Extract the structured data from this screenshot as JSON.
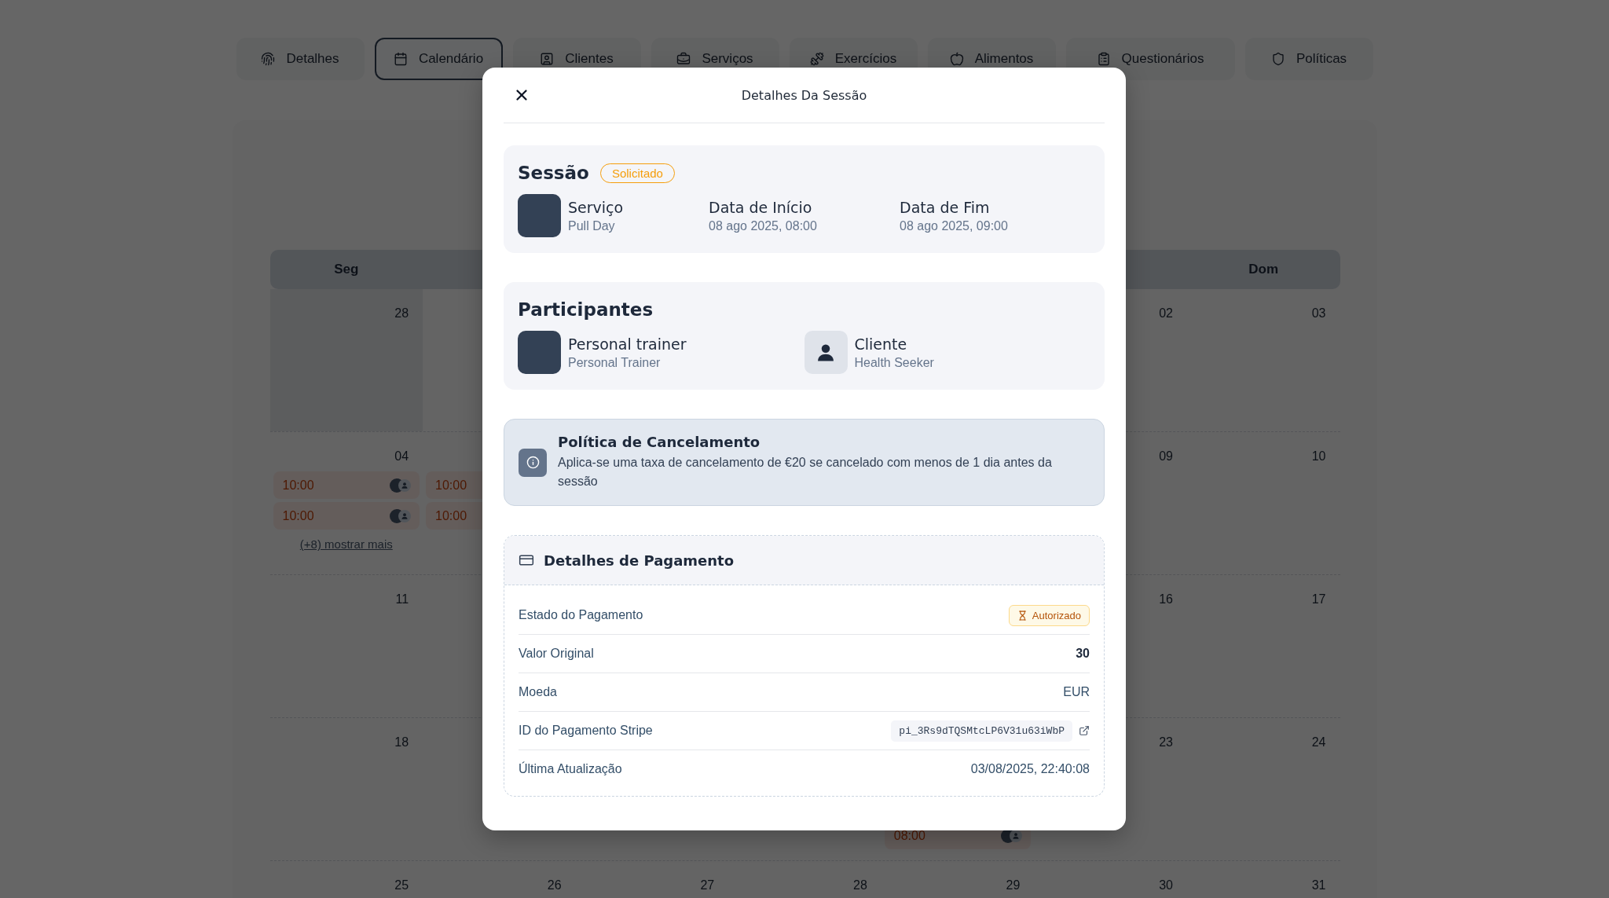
{
  "tabs": [
    {
      "label": "Detalhes",
      "selected": false
    },
    {
      "label": "Calendário",
      "selected": true
    },
    {
      "label": "Clientes",
      "selected": false
    },
    {
      "label": "Serviços",
      "selected": false
    },
    {
      "label": "Exercícios",
      "selected": false
    },
    {
      "label": "Alimentos",
      "selected": false
    },
    {
      "label": "Questionários",
      "selected": false
    },
    {
      "label": "Políticas",
      "selected": false
    }
  ],
  "calendar": {
    "weekdays": {
      "left": [
        "Seg"
      ],
      "right": [
        "Dom"
      ]
    },
    "weeks": [
      {
        "left": [
          {
            "day": "28",
            "in_month": false
          }
        ],
        "right": [
          {
            "day": "02",
            "in_month": true
          },
          {
            "day": "03",
            "in_month": true
          }
        ]
      },
      {
        "left": [
          {
            "day": "04",
            "in_month": true,
            "events": [
              {
                "time": "10:00"
              },
              {
                "time": "10:00"
              }
            ],
            "more_link": "(+8) mostrar mais"
          },
          {
            "events": [
              {
                "time": "10:00"
              },
              {
                "time": "10:00"
              }
            ]
          }
        ],
        "right": [
          {
            "day": "09",
            "in_month": true
          },
          {
            "day": "10",
            "in_month": true
          }
        ]
      },
      {
        "left": [
          {
            "day": "11",
            "in_month": true
          }
        ],
        "right": [
          {
            "day": "16",
            "in_month": true
          },
          {
            "day": "17",
            "in_month": true
          }
        ]
      },
      {
        "left": [
          {
            "day": "18",
            "in_month": true
          }
        ],
        "right": [
          {
            "events": [
              {
                "time": "08:00"
              }
            ]
          },
          {
            "day": "23",
            "in_month": true
          },
          {
            "day": "24",
            "in_month": true
          }
        ]
      },
      {
        "left": [
          {
            "day": "25",
            "in_month": true
          },
          {
            "day": "26",
            "in_month": true
          },
          {
            "day": "27",
            "in_month": true
          },
          {
            "day": "28",
            "in_month": true
          },
          {
            "day": "29",
            "in_month": true
          },
          {
            "day": "30",
            "in_month": true
          },
          {
            "day": "31",
            "in_month": true
          }
        ]
      }
    ]
  },
  "modal": {
    "title": "Detalhes Da Sessão",
    "session": {
      "heading": "Sessão",
      "status": "Solicitado",
      "fields": [
        {
          "label": "Serviço",
          "value": "Pull Day"
        },
        {
          "label": "Data de Início",
          "value": "08 ago 2025, 08:00"
        },
        {
          "label": "Data de Fim",
          "value": "08 ago 2025, 09:00"
        }
      ]
    },
    "participants": {
      "heading": "Participantes",
      "people": [
        {
          "kind": "photo",
          "name": "Personal trainer",
          "role": "Personal Trainer"
        },
        {
          "kind": "silhouette",
          "name": "Cliente",
          "role": "Health Seeker"
        }
      ]
    },
    "policy": {
      "title": "Política de Cancelamento",
      "text": "Aplica-se uma taxa de cancelamento de €20 se cancelado com menos de 1 dia antes da sessão"
    },
    "payment": {
      "heading": "Detalhes de Pagamento",
      "rows": [
        {
          "kind": "badge",
          "label": "Estado do Pagamento",
          "value": "Autorizado"
        },
        {
          "kind": "bold",
          "label": "Valor Original",
          "value": "30"
        },
        {
          "kind": "text",
          "label": "Moeda",
          "value": "EUR"
        },
        {
          "kind": "code",
          "label": "ID do Pagamento Stripe",
          "value": "pi_3Rs9dTQSMtcLP6V31u63iWbP"
        },
        {
          "kind": "text",
          "label": "Última Atualização",
          "value": "03/08/2025, 22:40:08"
        }
      ]
    }
  }
}
